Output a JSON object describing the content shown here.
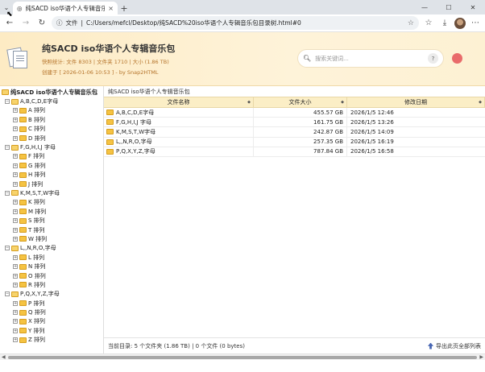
{
  "browser": {
    "tab_title": "纯SACD iso华语个人专辑音乐包",
    "tab_close": "×",
    "new_tab": "+",
    "window_controls": [
      "—",
      "☐",
      "✕"
    ],
    "address_chip": "文件",
    "url": "C:/Users/mefcl/Desktop/纯SACD%20iso华语个人专辑音乐包目录树.html#0",
    "icons": [
      "back-icon",
      "forward-icon",
      "reload-icon",
      "info-icon",
      "star-icon",
      "collections-icon",
      "download-icon",
      "profile-avatar",
      "more-icon"
    ]
  },
  "header": {
    "title": "纯SACD iso华语个人专辑音乐包",
    "stats": "快照统计: 文件 8303 | 文件夹 1710 | 大小 (1.86 TB)",
    "created": "创建于 [ 2026-01-06 10:53 ] - by Snap2HTML",
    "search_placeholder": "搜索关键词...",
    "help_label": "?"
  },
  "tree": {
    "root": "纯SACD iso华语个人专辑音乐包",
    "groups": [
      {
        "label": "A,B,C,D,E字母",
        "items": [
          "A 排列",
          "B 排列",
          "C 排列",
          "D 排列"
        ]
      },
      {
        "label": "F,G,H,I,J 字母",
        "items": [
          "F 排列",
          "G 排列",
          "H 排列",
          "J 排列"
        ]
      },
      {
        "label": "K,M,S,T,W字母",
        "items": [
          "K 排列",
          "M 排列",
          "S 排列",
          "T 排列",
          "W 排列"
        ]
      },
      {
        "label": "L,,N,R,O,字母",
        "items": [
          "L 排列",
          "N 排列",
          "O 排列",
          "R 排列"
        ]
      },
      {
        "label": "P,Q,X,Y,Z,字母",
        "items": [
          "P 排列",
          "Q 排列",
          "X 排列",
          "Y 排列",
          "Z 排列"
        ]
      }
    ]
  },
  "content": {
    "breadcrumb": "纯SACD iso华语个人专辑音乐包",
    "columns": {
      "name": "文件名称",
      "size": "文件大小",
      "date": "修改日期"
    },
    "rows": [
      {
        "name": "A,B,C,D,E字母",
        "size": "455.57 GB",
        "date": "2026/1/5 12:46"
      },
      {
        "name": "F,G,H,I,J 字母",
        "size": "161.75 GB",
        "date": "2026/1/5 13:26"
      },
      {
        "name": "K,M,S,T,W字母",
        "size": "242.87 GB",
        "date": "2026/1/5 14:09"
      },
      {
        "name": "L,,N,R,O,字母",
        "size": "257.35 GB",
        "date": "2026/1/5 16:19"
      },
      {
        "name": "P,Q,X,Y,Z,字母",
        "size": "787.84 GB",
        "date": "2026/1/5 16:58"
      }
    ],
    "status": "当前目录:  5 个文件夹 (1.86 TB) | 0 个文件 (0 bytes)",
    "export_label": "导出此页全部列表"
  },
  "colors": {
    "header_bg": "#fdebc4",
    "folder": "#f5c342",
    "accent": "#b5732a",
    "export_icon": "#4866b3"
  }
}
